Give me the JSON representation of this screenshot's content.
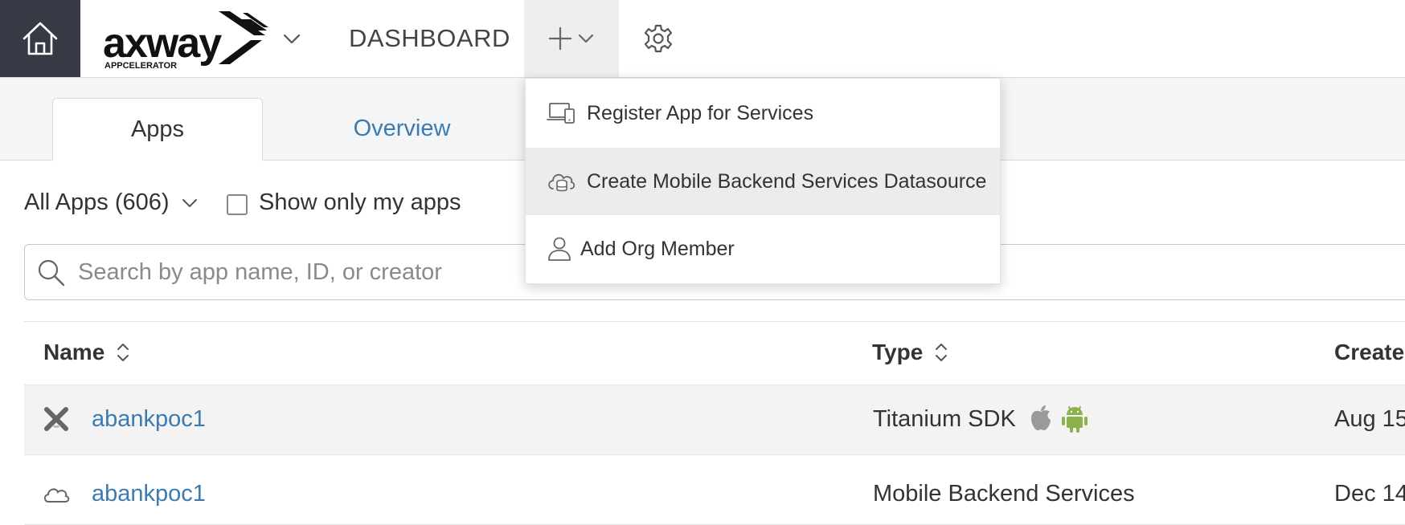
{
  "header": {
    "logo_text": "axway",
    "logo_subtext": "APPCELERATOR",
    "dashboard_label": "DASHBOARD"
  },
  "add_menu": {
    "items": [
      {
        "label": "Register App for Services",
        "icon": "devices-icon"
      },
      {
        "label": "Create Mobile Backend Services Datasource",
        "icon": "cloud-database-icon"
      },
      {
        "label": "Add Org Member",
        "icon": "user-icon"
      }
    ]
  },
  "tabs": [
    {
      "label": "Apps",
      "active": true
    },
    {
      "label": "Overview",
      "active": false
    }
  ],
  "filters": {
    "app_filter_label": "All Apps (606)",
    "show_only_mine_label": "Show only my apps"
  },
  "search": {
    "placeholder": "Search by app name, ID, or creator",
    "value": ""
  },
  "table": {
    "columns": [
      "Name",
      "Type",
      "Create"
    ],
    "rows": [
      {
        "name": "abankpoc1",
        "type": "Titanium SDK",
        "created": "Aug 15",
        "icon": "titanium-icon",
        "platforms": [
          "apple-icon",
          "android-icon"
        ]
      },
      {
        "name": "abankpoc1",
        "type": "Mobile Backend Services",
        "created": "Dec 14",
        "icon": "cloud-database-icon",
        "platforms": []
      }
    ]
  },
  "colors": {
    "home_bg": "#363a45",
    "link": "#3c7bb0",
    "android": "#8bb34a",
    "apple": "#9a9a9a"
  }
}
